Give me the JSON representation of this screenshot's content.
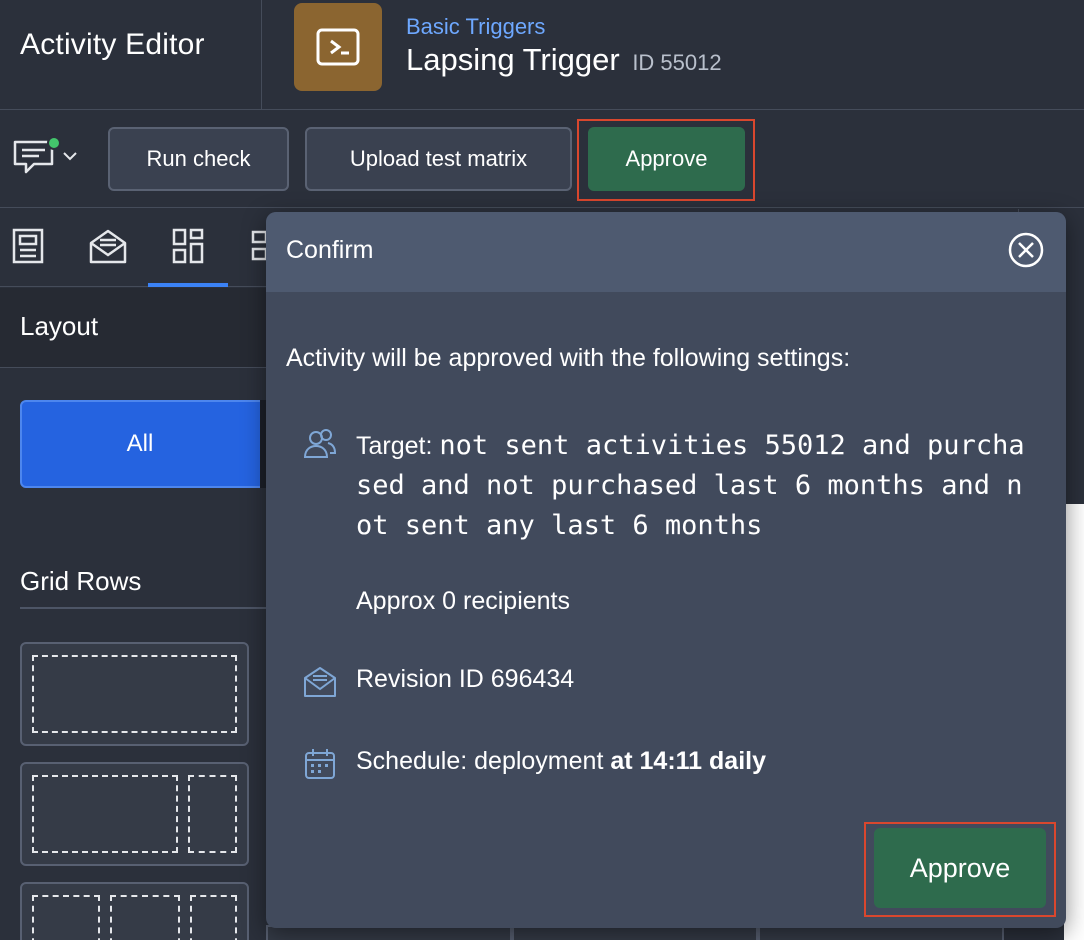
{
  "header": {
    "app_title": "Activity Editor",
    "breadcrumb": "Basic Triggers",
    "activity_name": "Lapsing Trigger",
    "activity_id": "ID 55012",
    "activity_icon": "message-forward-icon",
    "activity_icon_color": "#8b6530"
  },
  "toolbar": {
    "comment_icon": "comment-icon",
    "comment_status_color": "#43c66c",
    "run_check_label": "Run check",
    "upload_label": "Upload test matrix",
    "approve_label": "Approve",
    "approve_color": "#2e6b4d"
  },
  "left_panel": {
    "tabs": [
      {
        "icon": "document-icon"
      },
      {
        "icon": "email-icon"
      },
      {
        "icon": "layout-grid-icon",
        "active": true
      },
      {
        "icon": "blocks-icon"
      }
    ],
    "layout_title": "Layout",
    "filter_all_label": "All",
    "grid_rows_title": "Grid Rows"
  },
  "modal": {
    "title": "Confirm",
    "intro": "Activity will be approved with the following settings:",
    "target_label": "Target:",
    "target_value": "not sent activities 55012 and purchased and not purchased last 6 months and not sent any last 6 months",
    "recipients": "Approx 0 recipients",
    "revision": "Revision ID 696434",
    "schedule_prefix": "Schedule: deployment",
    "schedule_bold": "at 14:11 daily",
    "approve_label": "Approve"
  },
  "colors": {
    "accent_blue": "#2563e0",
    "link_blue": "#6ea8ff",
    "highlight_red": "#d9472e"
  }
}
